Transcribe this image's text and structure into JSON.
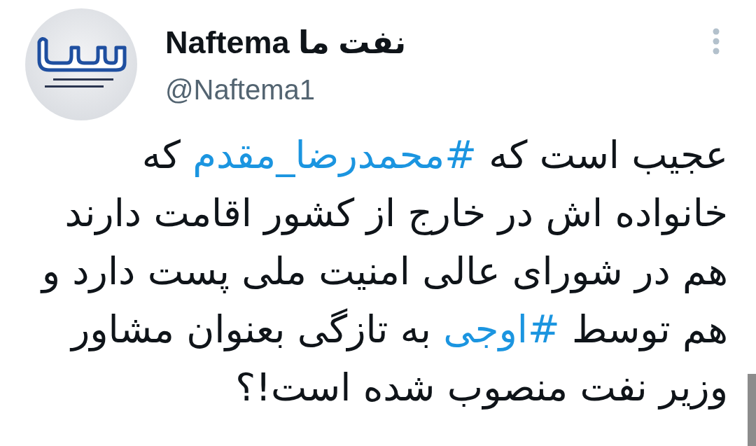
{
  "author": {
    "display_name": "Naftema نفت ما",
    "handle": "@Naftema1"
  },
  "tweet": {
    "segments": [
      {
        "kind": "text",
        "text": "عجیب است که "
      },
      {
        "kind": "hashtag",
        "text": "#محمدرضا_مقدم"
      },
      {
        "kind": "text",
        "text": " که خانواده اش در خارج از کشور اقامت دارند هم در شورای عالی امنیت ملی پست دارد و هم توسط "
      },
      {
        "kind": "hashtag",
        "text": "#اوجی"
      },
      {
        "kind": "text",
        "text": " به تازگی بعنوان مشاور وزیر نفت منصوب شده است!؟"
      }
    ]
  }
}
